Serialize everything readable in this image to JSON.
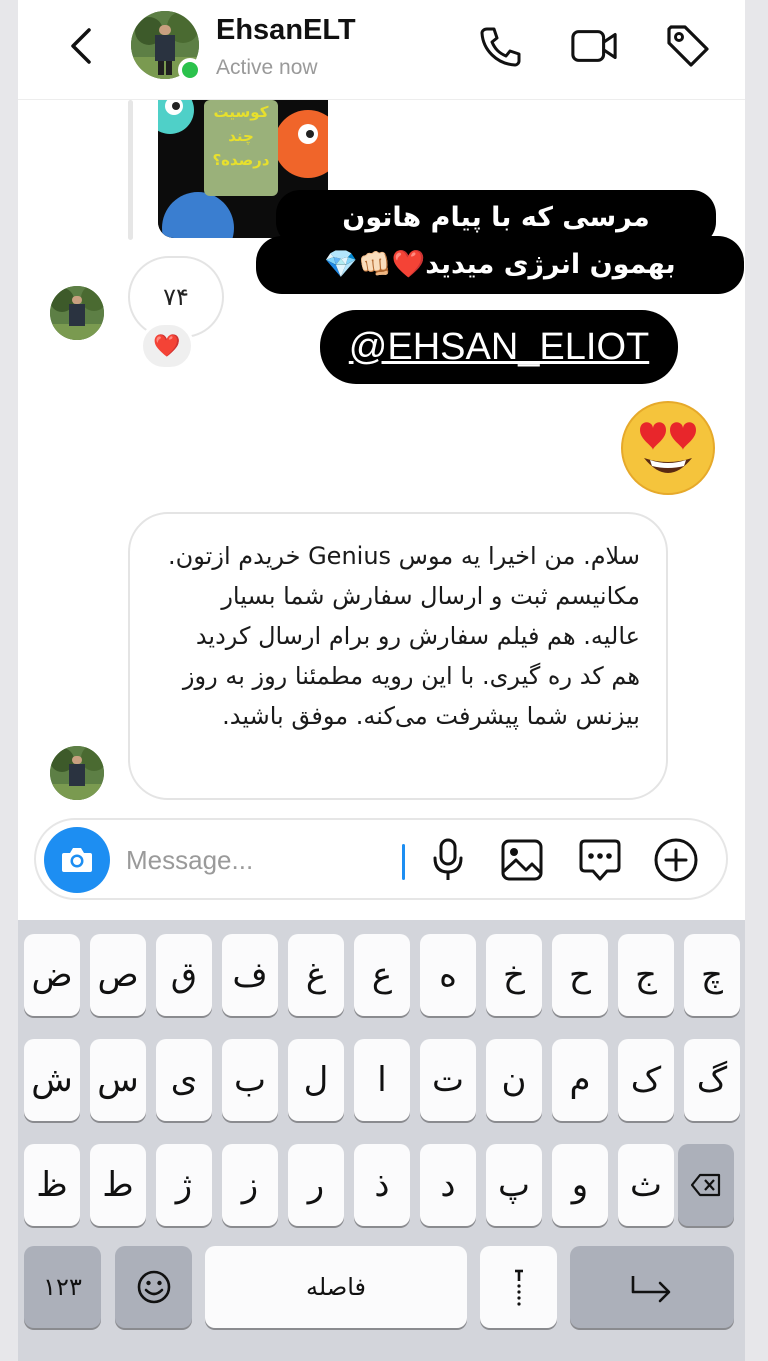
{
  "header": {
    "name": "EhsanELT",
    "status": "Active now"
  },
  "story": {
    "caption_line1": "مرسی که با پیام هاتون",
    "caption_line2": "بهمون انرژی میدید❤️👊🏻💎",
    "mention": "@EHSAN_ELIOT",
    "image_text_1": "کوسیت",
    "image_text_2": "چند",
    "image_text_3": "درصده؟"
  },
  "reply": {
    "text": "۷۴",
    "reaction": "❤️"
  },
  "message": {
    "text": "سلام. من اخیرا یه موس Genius خریدم ازتون. مکانیسم ثبت و ارسال سفارش شما بسیار عالیه. هم فیلم سفارش رو برام ارسال کردید هم کد ره گیری. با این رویه مطمئنا روز به روز بیزنس شما پیشرفت می‌کنه. موفق باشید."
  },
  "composer": {
    "placeholder": "Message..."
  },
  "keyboard": {
    "row1": [
      "ض",
      "ص",
      "ق",
      "ف",
      "غ",
      "ع",
      "ه",
      "خ",
      "ح",
      "ج",
      "چ"
    ],
    "row2": [
      "ش",
      "س",
      "ی",
      "ب",
      "ل",
      "ا",
      "ت",
      "ن",
      "م",
      "ک",
      "گ"
    ],
    "row3": [
      "ظ",
      "ط",
      "ژ",
      "ز",
      "ر",
      "ذ",
      "د",
      "پ",
      "و",
      "ث"
    ],
    "numbers_label": "۱۲۳",
    "space_label": "فاصله"
  },
  "colors": {
    "accent": "#1d8ef2",
    "online": "#2bc24c"
  }
}
